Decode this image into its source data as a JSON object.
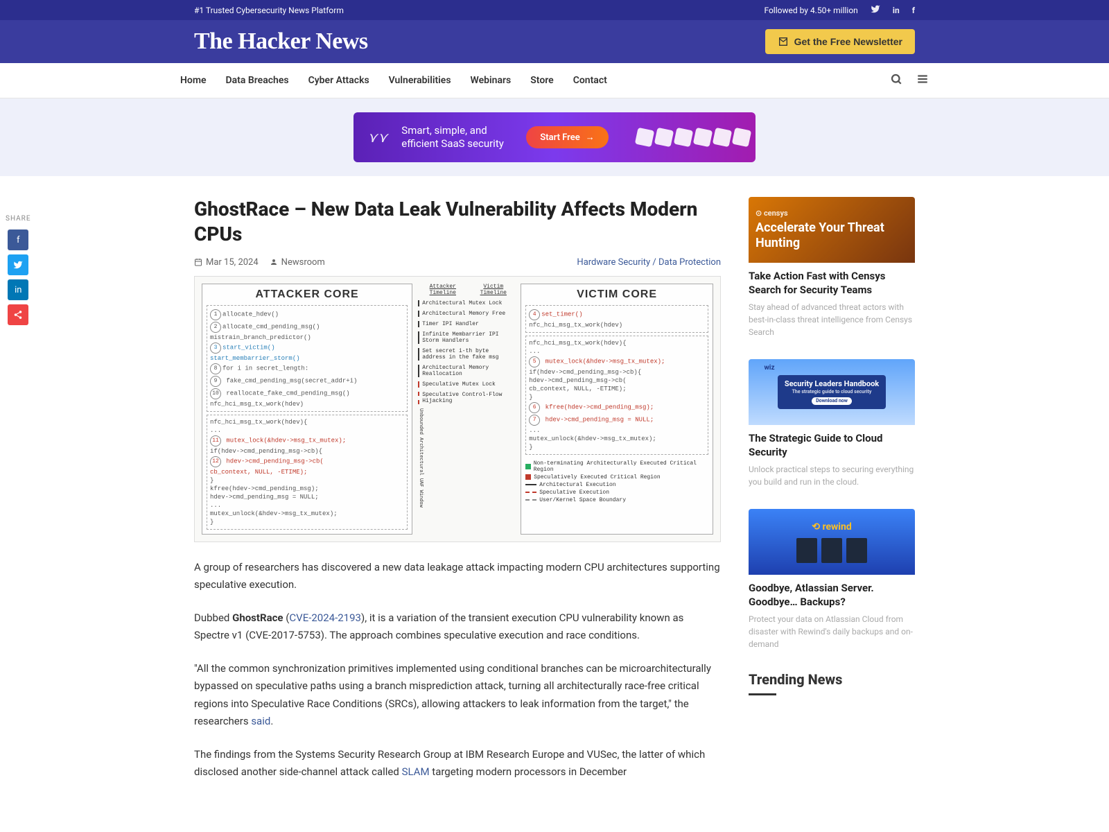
{
  "topbar": {
    "tagline": "#1 Trusted Cybersecurity News Platform",
    "followed": "Followed by 4.50+ million"
  },
  "header": {
    "logo": "The Hacker News",
    "newsletter_btn": "Get the Free Newsletter"
  },
  "nav": {
    "items": [
      "Home",
      "Data Breaches",
      "Cyber Attacks",
      "Vulnerabilities",
      "Webinars",
      "Store",
      "Contact"
    ]
  },
  "banner": {
    "text": "Smart, simple, and efficient SaaS security",
    "cta": "Start Free"
  },
  "share": {
    "label": "SHARE"
  },
  "article": {
    "title": "GhostRace – New Data Leak Vulnerability Affects Modern CPUs",
    "date": "Mar 15, 2024",
    "author": "Newsroom",
    "tags": "Hardware Security / Data Protection",
    "hero": {
      "attacker_title": "ATTACKER CORE",
      "victim_title": "VICTIM CORE",
      "attacker_tl": "Attacker Timeline",
      "victim_tl": "Victim Timeline",
      "attacker_lines": [
        "allocate_hdev()",
        "allocate_cmd_pending_msg()",
        "mistrain_branch_predictor()",
        "start_victim()",
        "start_membarrier_storm()",
        "for i in secret_length:",
        "  fake_cmd_pending_msg(secret_addr+i)",
        "  reallocate_fake_cmd_pending_msg()",
        "  nfc_hci_msg_tx_work(hdev)",
        "",
        "nfc_hci_msg_tx_work(hdev){",
        "  ...",
        "  mutex_lock(&hdev->msg_tx_mutex);",
        "  if(hdev->cmd_pending_msg->cb){",
        "    hdev->cmd_pending_msg->cb(",
        "    cb_context, NULL, -ETIME);",
        "  ...",
        "  }",
        "  kfree(hdev->cmd_pending_msg);",
        "  hdev->cmd_pending_msg = NULL;",
        "  ...",
        "  mutex_unlock(&hdev->msg_tx_mutex);",
        "}"
      ],
      "victim_lines": [
        "set_timer()",
        "nfc_hci_msg_tx_work(hdev)",
        "",
        "nfc_hci_msg_tx_work(hdev){",
        "  ...",
        "  mutex_lock(&hdev->msg_tx_mutex);",
        "  if(hdev->cmd_pending_msg->cb){",
        "    hdev->cmd_pending_msg->cb(",
        "    cb_context, NULL, -ETIME);",
        "  ...",
        "  }",
        "  kfree(hdev->cmd_pending_msg);",
        "  hdev->cmd_pending_msg = NULL;",
        "  ...",
        "  mutex_unlock(&hdev->msg_tx_mutex);",
        "}"
      ],
      "timeline_labels": [
        "Architectural Mutex Lock",
        "Architectural Memory Free",
        "Timer IPI Handler",
        "Infinite Membarrier IPI Storm Handlers",
        "Set secret i-th byte address in the fake msg",
        "Architectural Memory Reallocation",
        "Speculative Mutex Lock",
        "Speculative Control-Flow Hijacking"
      ],
      "legend": [
        "Non-terminating Architecturally Executed Critical Region",
        "Speculatively Executed Critical Region",
        "Architectural Execution",
        "Speculative Execution",
        "User/Kernel Space Boundary"
      ],
      "uaf_label": "Unbounded Architectural UAF Window"
    },
    "p1": "A group of researchers has discovered a new data leakage attack impacting modern CPU architectures supporting speculative execution.",
    "p2_a": "Dubbed ",
    "p2_strong": "GhostRace",
    "p2_b": " (",
    "p2_link": "CVE-2024-2193",
    "p2_c": "), it is a variation of the transient execution CPU vulnerability known as Spectre v1 (CVE-2017-5753). The approach combines speculative execution and race conditions.",
    "p3_a": "\"All the common synchronization primitives implemented using conditional branches can be microarchitecturally bypassed on speculative paths using a branch misprediction attack, turning all architecturally race-free critical regions into Speculative Race Conditions (SRCs), allowing attackers to leak information from the target,\" the researchers ",
    "p3_link": "said",
    "p3_b": ".",
    "p4_a": "The findings from the Systems Security Research Group at IBM Research Europe and VUSec, the latter of which disclosed another side-channel attack called ",
    "p4_link": "SLAM",
    "p4_b": " targeting modern processors in December"
  },
  "sidebar": {
    "widgets": [
      {
        "brand": "⊙ censys",
        "img_title": "Accelerate Your Threat Hunting",
        "title": "Take Action Fast with Censys Search for Security Teams",
        "desc": "Stay ahead of advanced threat actors with best-in-class threat intelligence from Censys Search"
      },
      {
        "brand": "wiz",
        "book_title": "Security Leaders Handbook",
        "book_sub": "The strategic guide to cloud security",
        "book_cta": "Download now",
        "title": "The Strategic Guide to Cloud Security",
        "desc": "Unlock practical steps to securing everything you build and run in the cloud."
      },
      {
        "brand": "⟲ rewind",
        "title": "Goodbye, Atlassian Server. Goodbye… Backups?",
        "desc": "Protect your data on Atlassian Cloud from disaster with Rewind's daily backups and on-demand"
      }
    ],
    "trending": "Trending News"
  }
}
